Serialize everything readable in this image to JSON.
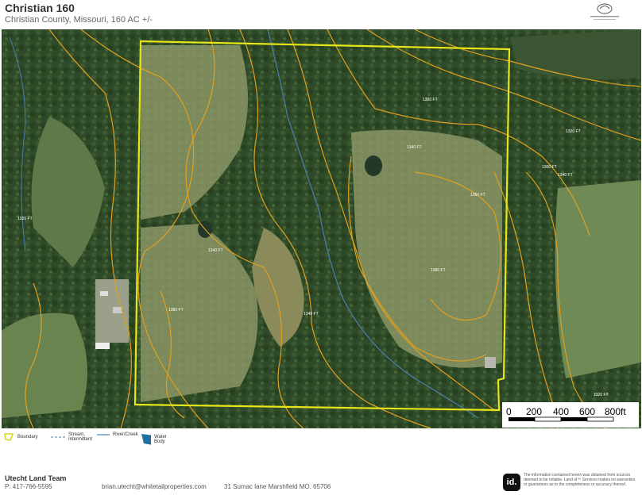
{
  "header": {
    "title": "Christian 160",
    "subtitle": "Christian County, Missouri, 160 AC +/-"
  },
  "map": {
    "contour_labels": [
      "1300 FT",
      "1320 FT",
      "1340 FT",
      "1360 FT",
      "1380 FT",
      "1260 FT",
      "1280 FT"
    ],
    "boundary_color": "#e6e619",
    "contour_color": "#e0a020",
    "stream_color": "#4a7fb0"
  },
  "scale": {
    "ticks": [
      "0",
      "200",
      "400",
      "600",
      "800ft"
    ]
  },
  "legend": {
    "items": [
      {
        "label": "Boundary"
      },
      {
        "label": "Stream, Intermittent"
      },
      {
        "label": "River/Creek"
      },
      {
        "label": "Water Body"
      }
    ]
  },
  "footer": {
    "team": "Utecht Land Team",
    "phone": "P: 417-766-5595",
    "email": "brian.utecht@whitetailproperties.com",
    "address": "31 Sumac lane Marshfield MO. 65706",
    "id_logo": "id.",
    "disclaimer": "The information contained herein was obtained from sources deemed to be reliable. Land id™ Services makes no warranties or guarantees as to the completeness or accuracy thereof."
  }
}
